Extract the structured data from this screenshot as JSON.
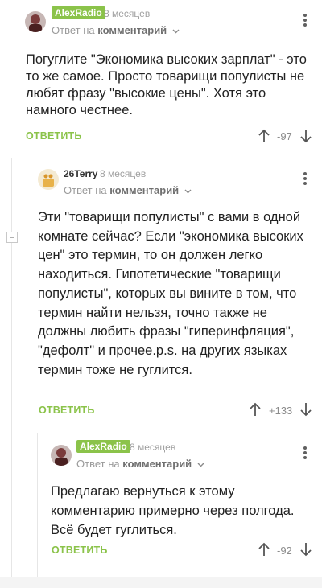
{
  "comments": [
    {
      "author": "AlexRadio",
      "time": "8 месяцев",
      "reply_prefix": "Ответ на",
      "reply_target": "комментарий",
      "body": "Погуглите \"Экономика высоких зарплат\" - это то же самое. Просто товарищи популисты не любят фразу \"высокие цены\". Хотя это намного честнее.",
      "reply_label": "ОТВЕТИТЬ",
      "rating": "-97"
    },
    {
      "author": "26Terry",
      "time": "8 месяцев",
      "reply_prefix": "Ответ на",
      "reply_target": "комментарий",
      "body": "Эти \"товарищи популисты\" с вами в одной комнате сейчас? Если \"экономика высоких цен\" это термин, то он должен легко находиться. Гипотетические \"товарищи популисты\", которых вы вините в том, что термин найти нельзя, точно также не должны любить фразы \"гиперинфляция\", \"дефолт\" и прочее.p.s. на других языках термин тоже не гуглится.",
      "reply_label": "ОТВЕТИТЬ",
      "rating": "+133"
    },
    {
      "author": "AlexRadio",
      "time": "8 месяцев",
      "reply_prefix": "Ответ на",
      "reply_target": "комментарий",
      "body": "Предлагаю вернуться к этому комментарию примерно через полгода. Всё будет гуглиться.",
      "reply_label": "ОТВЕТИТЬ",
      "rating": "-92"
    }
  ],
  "colors": {
    "accent": "#8bc34a",
    "text": "#222222",
    "muted": "#9a9a9a"
  },
  "icons": [
    "avatar",
    "chevron-down-icon",
    "more-vert-icon",
    "arrow-up-icon",
    "arrow-down-icon",
    "collapse-icon"
  ]
}
